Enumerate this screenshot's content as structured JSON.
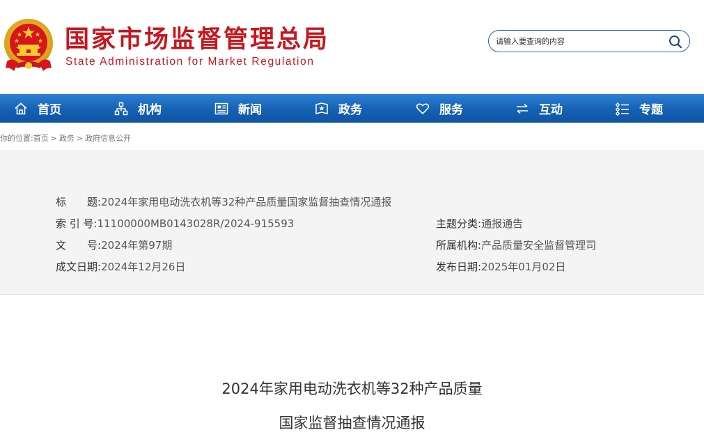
{
  "header": {
    "brand_cn": "国家市场监督管理总局",
    "brand_en": "State Administration for Market Regulation",
    "search_placeholder": "请输入要查询的内容",
    "brand_color": "#c8161d"
  },
  "nav": {
    "items": [
      {
        "label": "首页",
        "icon": "home-icon"
      },
      {
        "label": "机构",
        "icon": "org-chart-icon"
      },
      {
        "label": "新闻",
        "icon": "newspaper-icon"
      },
      {
        "label": "政务",
        "icon": "government-book-icon"
      },
      {
        "label": "服务",
        "icon": "heart-icon"
      },
      {
        "label": "互动",
        "icon": "exchange-arrows-icon"
      },
      {
        "label": "专题",
        "icon": "topic-list-icon"
      }
    ],
    "color": "#1561b4"
  },
  "breadcrumb": {
    "prefix": "你的位置:",
    "items": [
      "首页",
      "政务",
      "政府信息公开"
    ],
    "separator": ">"
  },
  "info": {
    "title_label": "标　　题:",
    "title_value": "2024年家用电动洗衣机等32种产品质量国家监督抽查情况通报",
    "index_label": "索 引 号:",
    "index_value": "11100000MB0143028R/2024-915593",
    "category_label": "主题分类:",
    "category_value": "通报通告",
    "docno_label": "文　　号:",
    "docno_value": "2024年第97期",
    "org_label": "所属机构:",
    "org_value": "产品质量安全监督管理司",
    "created_label": "成文日期:",
    "created_value": "2024年12月26日",
    "published_label": "发布日期:",
    "published_value": "2025年01月02日"
  },
  "article": {
    "title_line1": "2024年家用电动洗衣机等32种产品质量",
    "title_line2": "国家监督抽查情况通报"
  }
}
